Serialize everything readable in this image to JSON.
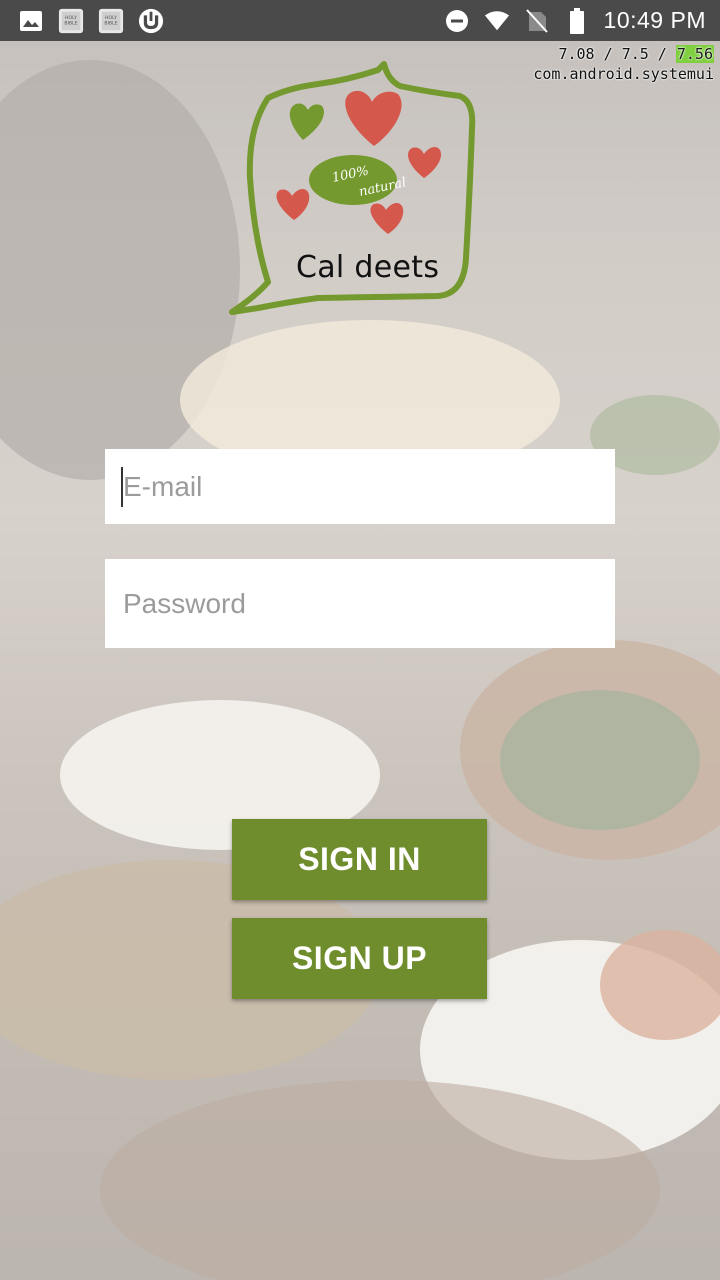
{
  "status_bar": {
    "time": "10:49 PM",
    "left_icons": [
      "image-icon",
      "holy-bible-icon",
      "holy-bible-icon",
      "utorrent-icon"
    ],
    "right_icons": [
      "do-not-disturb-icon",
      "wifi-icon",
      "no-sim-icon",
      "battery-icon"
    ]
  },
  "debug_overlay": {
    "line1_a": "7.08",
    "sep1": " / ",
    "line1_b": "7.5",
    "sep2": " / ",
    "line1_c": "7.56",
    "line2": "com.android.systemui"
  },
  "logo": {
    "badge_line1": "100%",
    "badge_line2": "natural",
    "title": "Cal deets"
  },
  "form": {
    "email_placeholder": "E-mail",
    "email_value": "",
    "password_placeholder": "Password",
    "password_value": ""
  },
  "buttons": {
    "sign_in": "SIGN IN",
    "sign_up": "SIGN UP"
  },
  "colors": {
    "brand_green": "#6f8d2c",
    "heart_red": "#d4584b",
    "logo_green": "#74992e",
    "status_bar": "#4a4a4a"
  }
}
